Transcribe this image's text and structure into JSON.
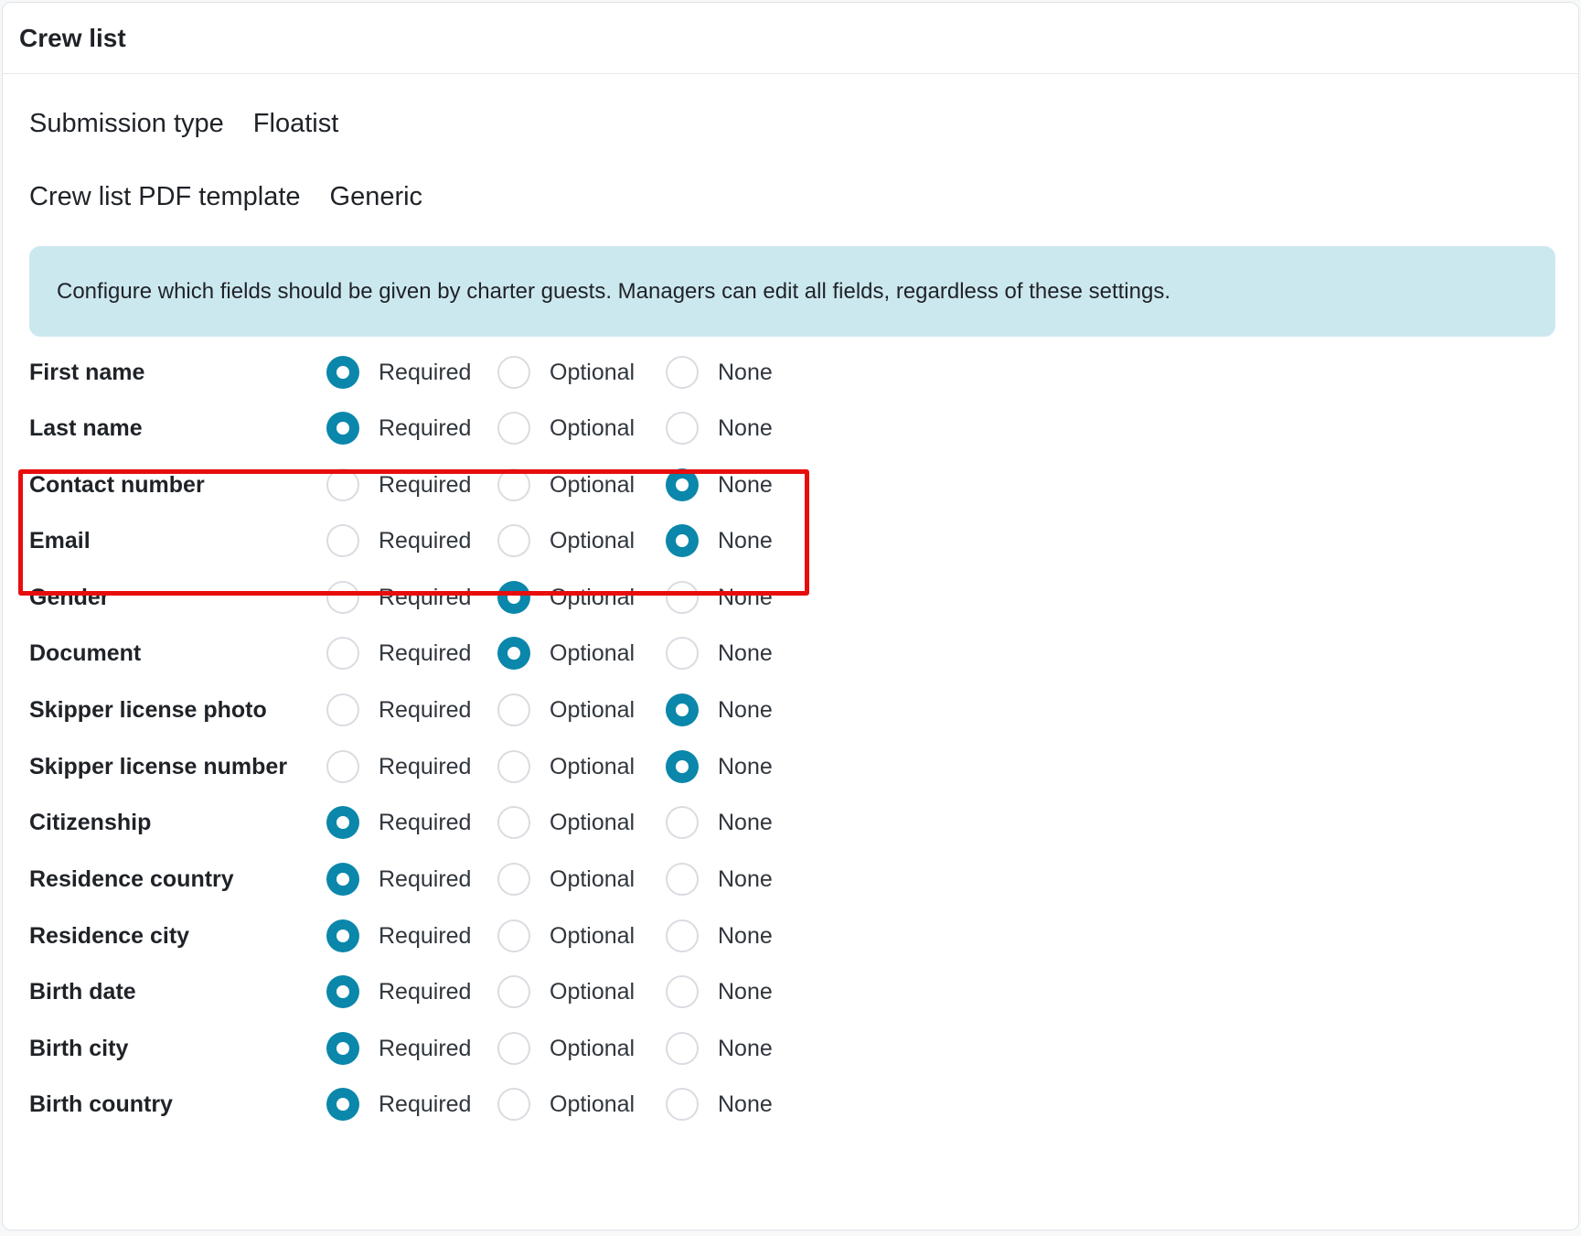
{
  "header": {
    "title": "Crew list"
  },
  "submission": {
    "label": "Submission type",
    "value": "Floatist"
  },
  "template": {
    "label": "Crew list PDF template",
    "value": "Generic"
  },
  "alert": {
    "text": "Configure which fields should be given by charter guests. Managers can edit all fields, regardless of these settings."
  },
  "options": {
    "required": "Required",
    "optional": "Optional",
    "none": "None"
  },
  "colors": {
    "accent": "#0a87aa",
    "highlight": "#e80d0d",
    "alert_bg": "#cce8ef"
  },
  "fields": [
    {
      "label": "First name",
      "selected": "required"
    },
    {
      "label": "Last name",
      "selected": "required"
    },
    {
      "label": "Contact number",
      "selected": "none"
    },
    {
      "label": "Email",
      "selected": "none"
    },
    {
      "label": "Gender",
      "selected": "optional"
    },
    {
      "label": "Document",
      "selected": "optional"
    },
    {
      "label": "Skipper license photo",
      "selected": "none"
    },
    {
      "label": "Skipper license number",
      "selected": "none"
    },
    {
      "label": "Citizenship",
      "selected": "required"
    },
    {
      "label": "Residence country",
      "selected": "required"
    },
    {
      "label": "Residence city",
      "selected": "required"
    },
    {
      "label": "Birth date",
      "selected": "required"
    },
    {
      "label": "Birth city",
      "selected": "required"
    },
    {
      "label": "Birth country",
      "selected": "required"
    }
  ]
}
